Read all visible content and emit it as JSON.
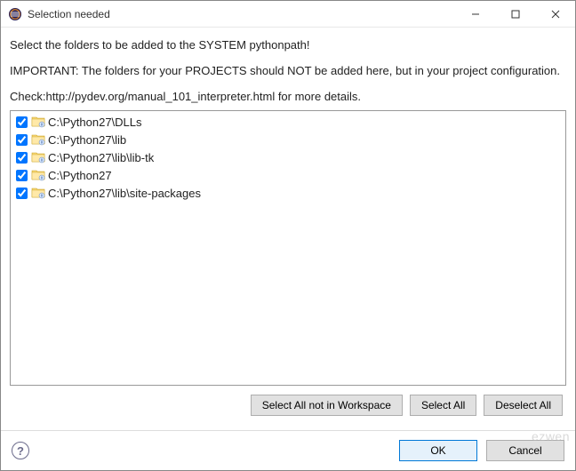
{
  "window": {
    "title": "Selection needed"
  },
  "content": {
    "instruction": "Select the folders to be added to the SYSTEM pythonpath!",
    "important": "IMPORTANT: The folders for your PROJECTS should NOT be added here, but in your project configuration.",
    "check_line": "Check:http://pydev.org/manual_101_interpreter.html for more details."
  },
  "folders": [
    {
      "checked": true,
      "path": "C:\\Python27\\DLLs"
    },
    {
      "checked": true,
      "path": "C:\\Python27\\lib"
    },
    {
      "checked": true,
      "path": "C:\\Python27\\lib\\lib-tk"
    },
    {
      "checked": true,
      "path": "C:\\Python27"
    },
    {
      "checked": true,
      "path": "C:\\Python27\\lib\\site-packages"
    }
  ],
  "buttons": {
    "select_not_workspace": "Select All not in Workspace",
    "select_all": "Select All",
    "deselect_all": "Deselect All",
    "ok": "OK",
    "cancel": "Cancel",
    "help": "?"
  },
  "watermark": "ezwen"
}
